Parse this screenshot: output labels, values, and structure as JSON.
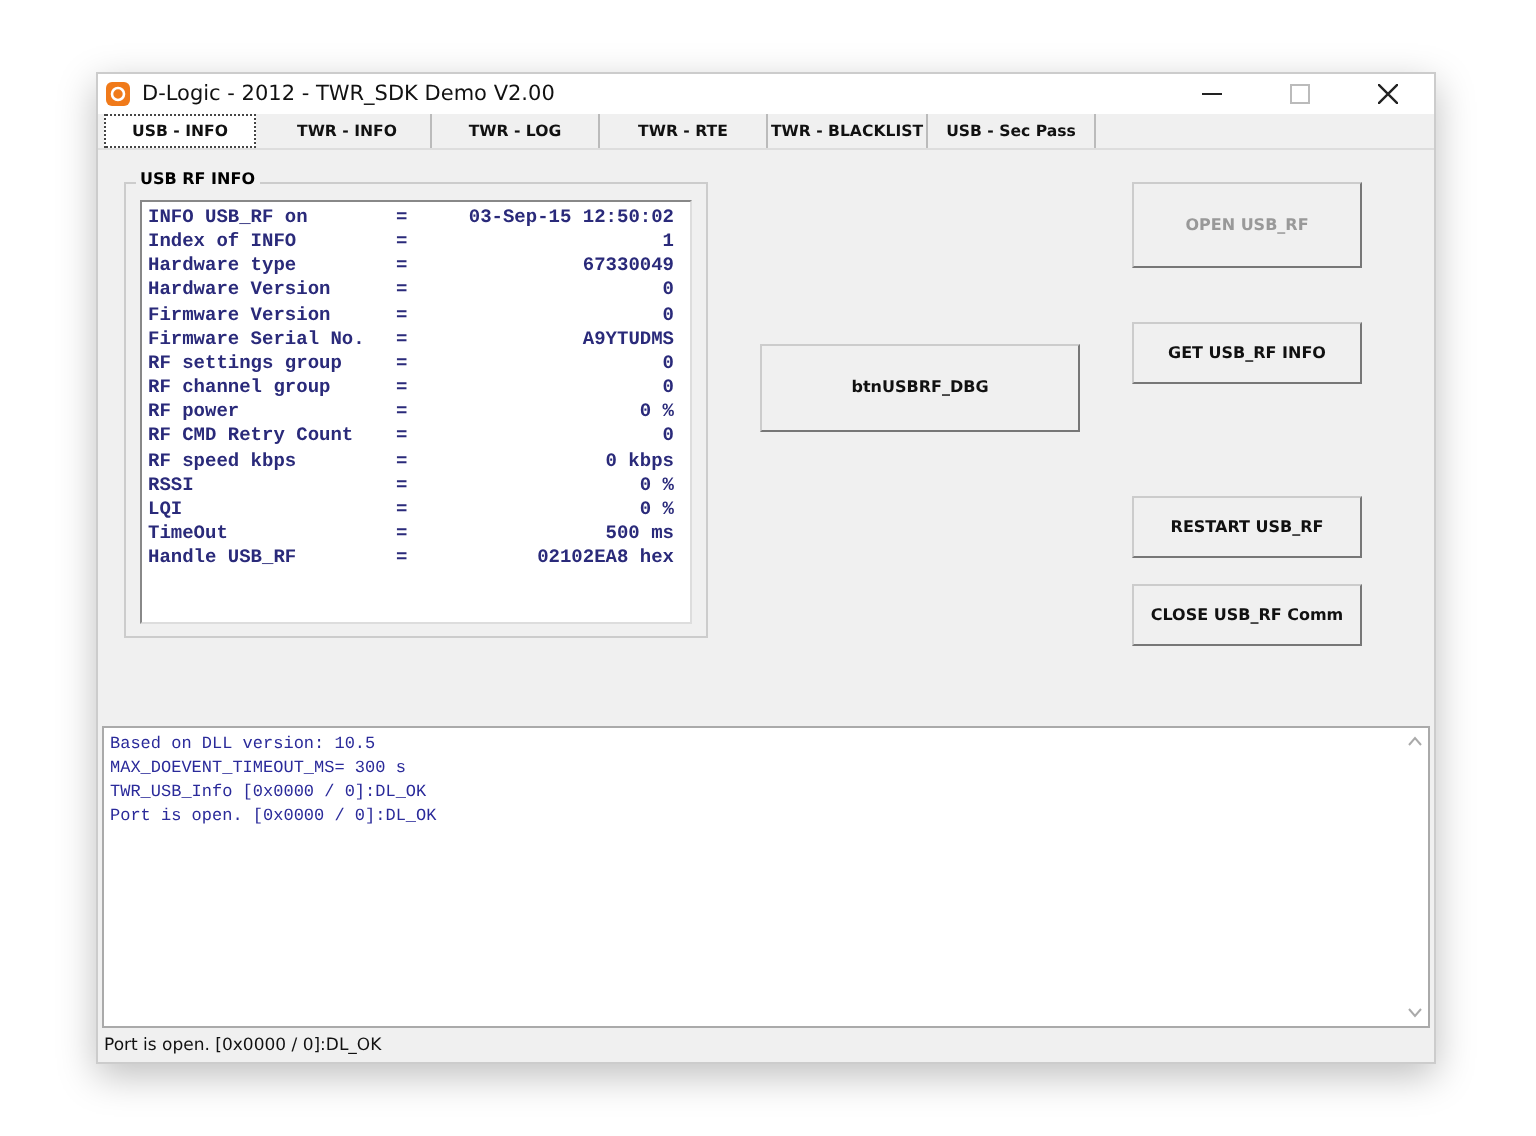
{
  "window": {
    "title": "D-Logic - 2012  - TWR_SDK Demo V2.00"
  },
  "tabs": [
    {
      "label": "USB - INFO",
      "selected": true
    },
    {
      "label": "TWR - INFO",
      "selected": false
    },
    {
      "label": "TWR - LOG",
      "selected": false
    },
    {
      "label": "TWR - RTE",
      "selected": false
    },
    {
      "label": "TWR - BLACKLIST",
      "selected": false
    },
    {
      "label": "USB - Sec Pass",
      "selected": false
    }
  ],
  "info_group": {
    "title": "USB RF INFO",
    "rows": [
      {
        "label": "INFO USB_RF on",
        "sep": "=",
        "value": "03-Sep-15 12:50:02"
      },
      {
        "label": "Index of INFO",
        "sep": "=",
        "value": "1"
      },
      {
        "label": "Hardware type",
        "sep": "=",
        "value": "67330049"
      },
      {
        "label": "Hardware Version",
        "sep": "=",
        "value": "0"
      },
      {
        "label": "Firmware Version",
        "sep": "=",
        "value": "0"
      },
      {
        "label": "Firmware Serial No.",
        "sep": "=",
        "value": "A9YTUDMS"
      },
      {
        "label": "RF settings group",
        "sep": "=",
        "value": "0"
      },
      {
        "label": "RF channel group",
        "sep": "=",
        "value": "0"
      },
      {
        "label": "RF power",
        "sep": "=",
        "value": "0 %"
      },
      {
        "label": "RF CMD Retry Count",
        "sep": "=",
        "value": "0"
      },
      {
        "label": "RF speed kbps",
        "sep": "=",
        "value": "0 kbps"
      },
      {
        "label": "RSSI",
        "sep": "=",
        "value": "0 %"
      },
      {
        "label": "LQI",
        "sep": "=",
        "value": "0 %"
      },
      {
        "label": "TimeOut",
        "sep": "=",
        "value": "500 ms"
      },
      {
        "label": "Handle USB_RF",
        "sep": "=",
        "value": "02102EA8 hex"
      }
    ]
  },
  "debug_button": {
    "label": "btnUSBRF_DBG",
    "disabled": false
  },
  "buttons": [
    {
      "label": "OPEN USB_RF",
      "disabled": true
    },
    {
      "label": "GET USB_RF INFO",
      "disabled": false
    },
    {
      "label": "RESTART USB_RF",
      "disabled": false
    },
    {
      "label": "CLOSE USB_RF Comm",
      "disabled": false
    }
  ],
  "log": [
    "Based on DLL version: 10.5",
    "MAX_DOEVENT_TIMEOUT_MS= 300 s",
    "TWR_USB_Info [0x0000 / 0]:DL_OK",
    "Port is open. [0x0000 / 0]:DL_OK"
  ],
  "status_bar": "Port is open. [0x0000 / 0]:DL_OK"
}
